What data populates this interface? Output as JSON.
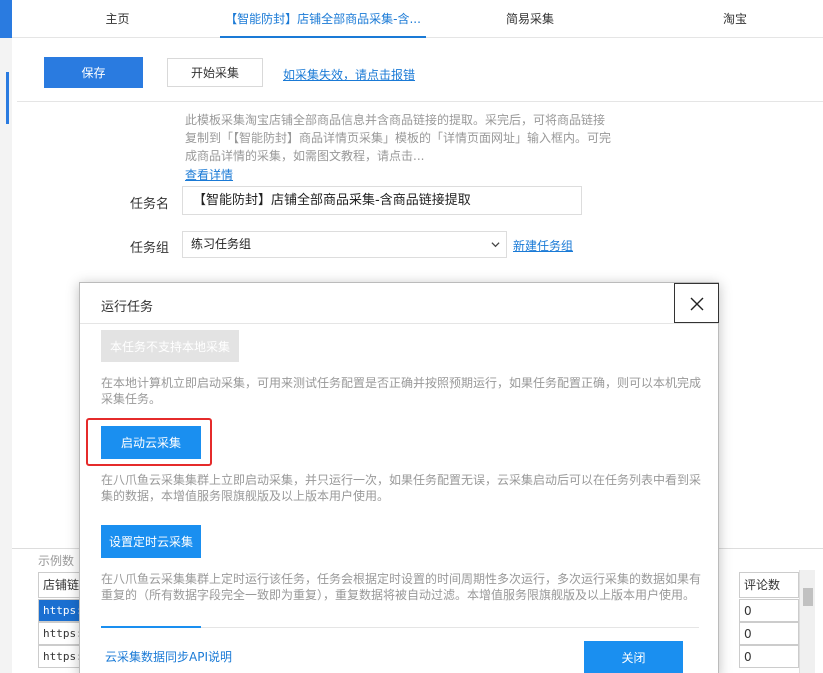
{
  "tabs": [
    {
      "label": "主页"
    },
    {
      "label": "【智能防封】店铺全部商品采集-含..."
    },
    {
      "label": "简易采集"
    },
    {
      "label": "淘宝"
    }
  ],
  "toolbar": {
    "save_label": "保存",
    "start_label": "开始采集",
    "report_link": "如采集失效，请点击报错"
  },
  "template": {
    "description": "此模板采集淘宝店铺全部商品信息并含商品链接的提取。采完后，可将商品链接复制到「【智能防封】商品详情页采集」模板的「详情页面网址」输入框内。可完成商品详情的采集，如需图文教程，请点击...",
    "detail_link": "查看详情"
  },
  "form": {
    "task_name_label": "任务名",
    "task_name_value": "【智能防封】店铺全部商品采集-含商品链接提取",
    "task_group_label": "任务组",
    "task_group_value": "练习任务组",
    "new_group_link": "新建任务组"
  },
  "sample_table": {
    "label": "示例数",
    "header_first": "店铺链",
    "header_last": "评论数",
    "rows": [
      {
        "url": "https:",
        "comments": "0"
      },
      {
        "url": "https:",
        "comments": "0"
      },
      {
        "url": "https:",
        "comments": "0"
      }
    ]
  },
  "modal": {
    "title": "运行任务",
    "local_btn": "本任务不支持本地采集",
    "local_desc": "在本地计算机立即启动采集，可用来测试任务配置是否正确并按照预期运行，如果任务配置正确，则可以本机完成采集任务。",
    "cloud_btn": "启动云采集",
    "cloud_desc": "在八爪鱼云采集集群上立即启动采集，并只运行一次，如果任务配置无误，云采集启动后可以在任务列表中看到采集的数据，本增值服务限旗舰版及以上版本用户使用。",
    "schedule_btn": "设置定时云采集",
    "schedule_desc": "在八爪鱼云采集集群上定时运行该任务，任务会根据定时设置的时间周期性多次运行，多次运行采集的数据如果有重复的（所有数据字段完全一致即为重复），重复数据将被自动过滤。本增值服务限旗舰版及以上版本用户使用。",
    "api_link": "云采集数据同步API说明",
    "close_btn": "关闭"
  }
}
